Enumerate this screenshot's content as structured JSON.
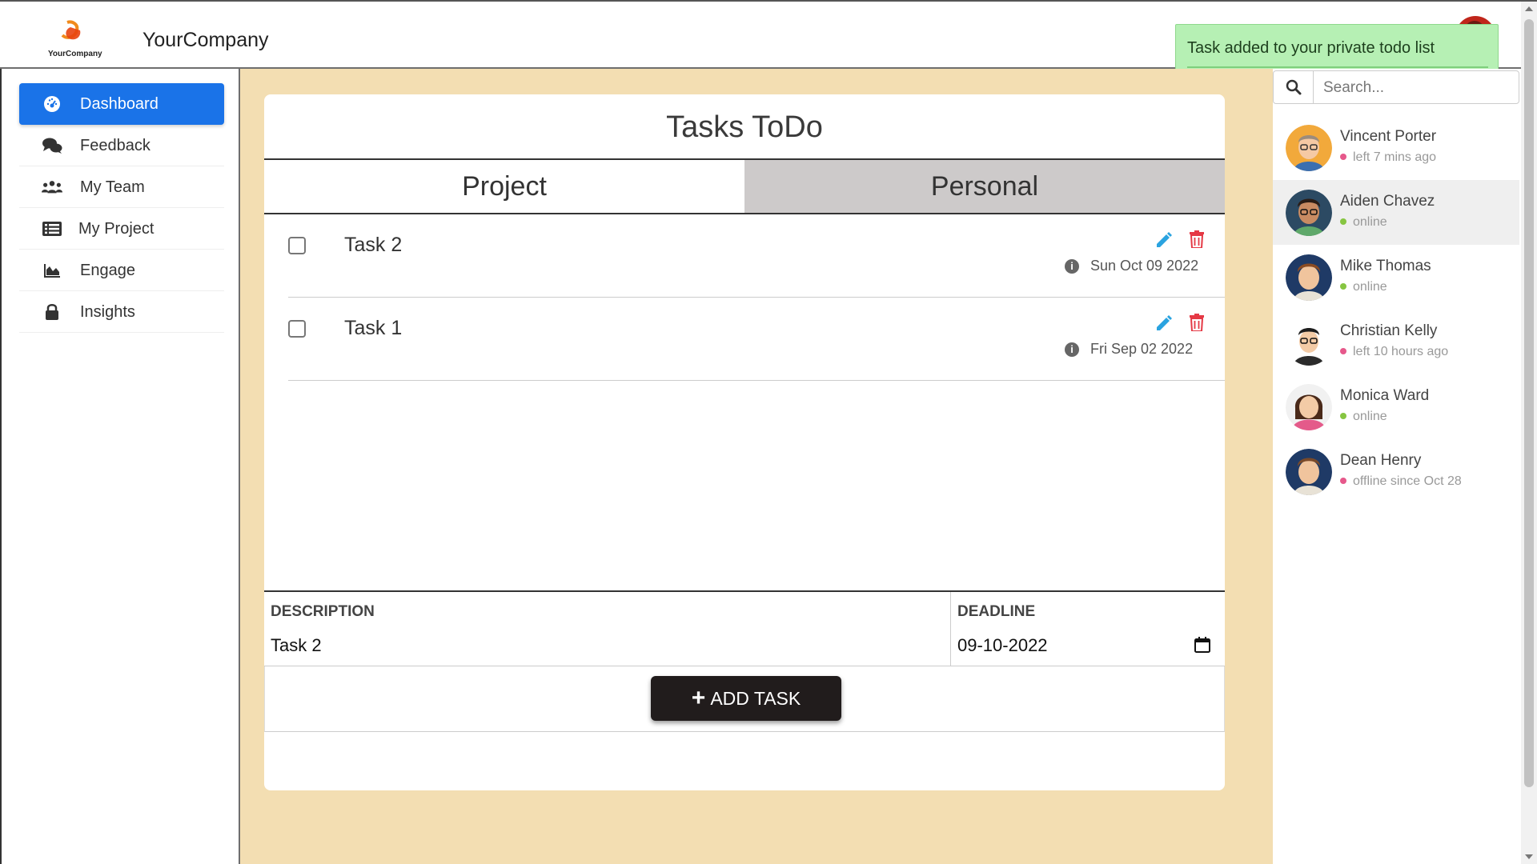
{
  "header": {
    "brand": "YourCompany",
    "logo_text": "YourCompany"
  },
  "toast": {
    "message": "Task added to your private todo list"
  },
  "sidebar": {
    "items": [
      {
        "label": "Dashboard",
        "icon": "dashboard-icon",
        "active": true
      },
      {
        "label": "Feedback",
        "icon": "comments-icon"
      },
      {
        "label": "My Team",
        "icon": "users-icon"
      },
      {
        "label": "My Project",
        "icon": "list-icon"
      },
      {
        "label": "Engage",
        "icon": "area-chart-icon"
      },
      {
        "label": "Insights",
        "icon": "lock-icon"
      }
    ]
  },
  "todo": {
    "title": "Tasks ToDo",
    "tabs": [
      {
        "label": "Project",
        "active": true
      },
      {
        "label": "Personal",
        "active": false
      }
    ],
    "tasks": [
      {
        "name": "Task 2",
        "date": "Sun Oct 09 2022",
        "checked": false
      },
      {
        "name": "Task 1",
        "date": "Fri Sep 02 2022",
        "checked": false
      }
    ],
    "form": {
      "description_label": "DESCRIPTION",
      "description_value": "Task 2",
      "deadline_label": "DEADLINE",
      "deadline_value": "09-10-2022",
      "add_button": "ADD TASK"
    }
  },
  "contacts": {
    "search_placeholder": "Search...",
    "list": [
      {
        "name": "Vincent Porter",
        "status": "left 7 mins ago",
        "state": "away"
      },
      {
        "name": "Aiden Chavez",
        "status": "online",
        "state": "online"
      },
      {
        "name": "Mike Thomas",
        "status": "online",
        "state": "online"
      },
      {
        "name": "Christian Kelly",
        "status": "left 10 hours ago",
        "state": "away"
      },
      {
        "name": "Monica Ward",
        "status": "online",
        "state": "online"
      },
      {
        "name": "Dean Henry",
        "status": "offline since Oct 28",
        "state": "away"
      }
    ]
  },
  "colors": {
    "accent": "#1a73e8",
    "main_bg": "#f3deb2",
    "toast_bg": "#b6f0b4",
    "online": "#86c541",
    "away": "#e6588b",
    "edit": "#2aa3e0",
    "delete": "#e53945"
  }
}
